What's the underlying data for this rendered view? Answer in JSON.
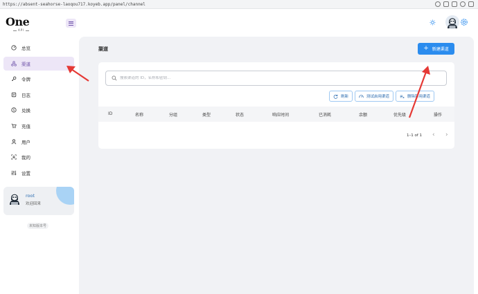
{
  "browser": {
    "url": "https://absent-seahorse-laoqou717.koyeb.app/panel/channel"
  },
  "sidebar": {
    "logo": "One",
    "logo_sub": "API",
    "items": [
      {
        "label": "总览",
        "icon": "dashboard-icon"
      },
      {
        "label": "渠道",
        "icon": "channel-icon",
        "active": true
      },
      {
        "label": "令牌",
        "icon": "key-icon"
      },
      {
        "label": "日志",
        "icon": "log-icon"
      },
      {
        "label": "兑换",
        "icon": "redeem-icon"
      },
      {
        "label": "充值",
        "icon": "cart-icon"
      },
      {
        "label": "用户",
        "icon": "user-icon"
      },
      {
        "label": "我的",
        "icon": "profile-icon"
      },
      {
        "label": "设置",
        "icon": "settings-icon"
      }
    ],
    "user": {
      "name": "root",
      "welcome": "欢迎回来"
    },
    "version": "未知版本号"
  },
  "main": {
    "title": "渠道",
    "new_button": "新建渠道",
    "search_placeholder": "搜索渠道的 ID，名称和密钥...",
    "actions": [
      "刷新",
      "测试启用渠道",
      "删除禁用渠道"
    ],
    "columns": [
      "ID",
      "名称",
      "分组",
      "类型",
      "状态",
      "响应时间",
      "已消耗",
      "余额",
      "优先级",
      "操作"
    ],
    "pagination": "1–1 of 1"
  },
  "colors": {
    "accent": "#2b8cee",
    "active_nav_bg": "#ede6f7",
    "active_nav_text": "#6b4fa8",
    "annotation": "#e53935"
  }
}
